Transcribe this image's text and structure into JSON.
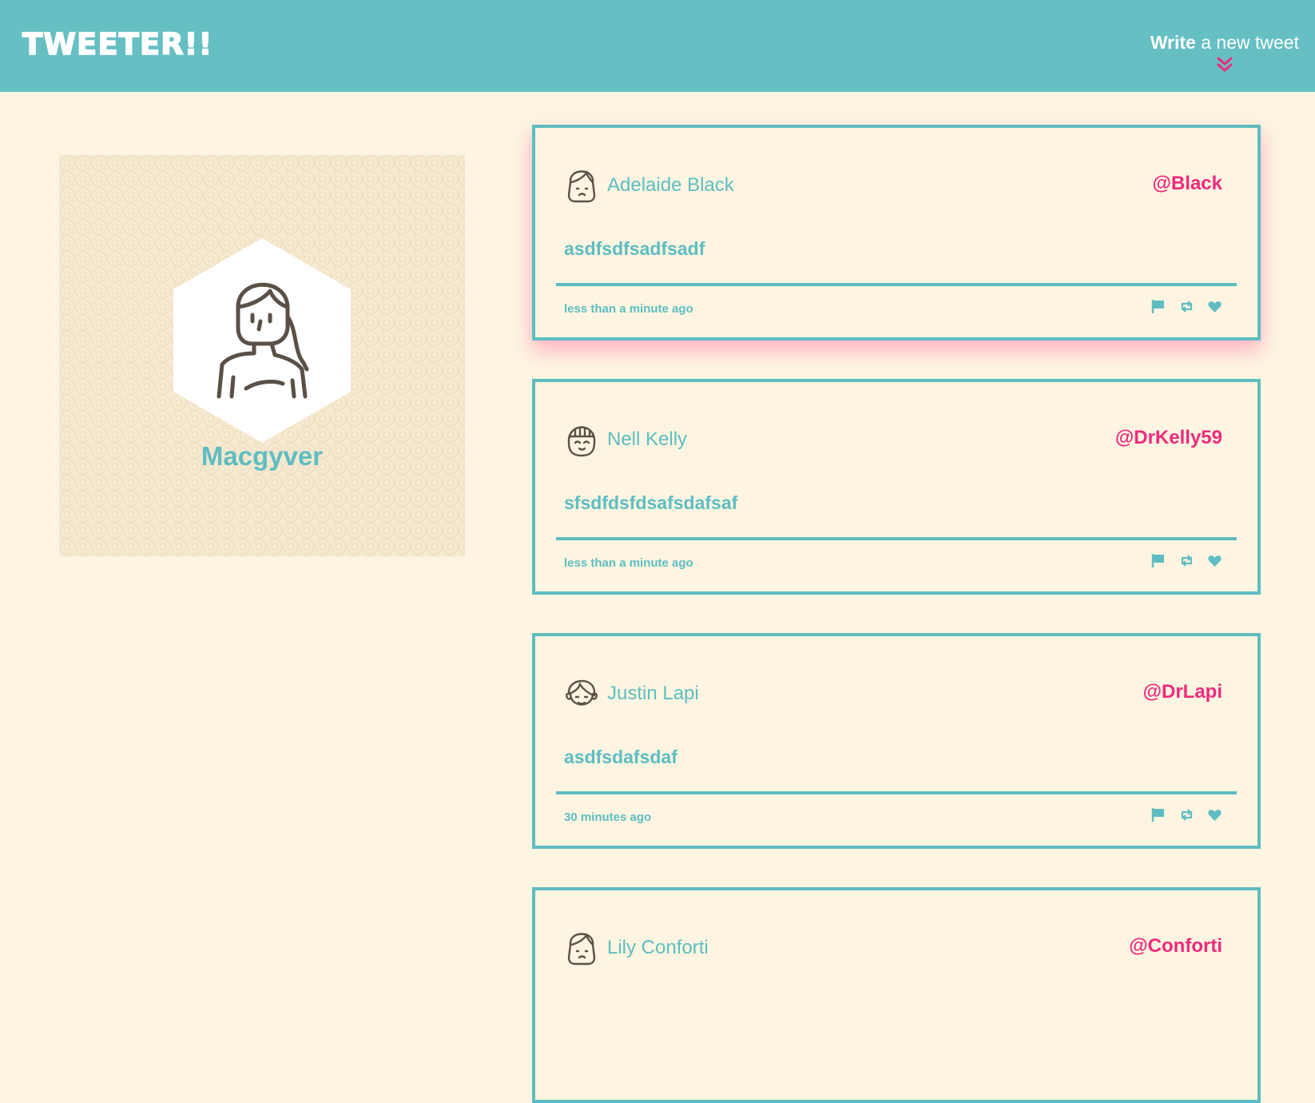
{
  "nav": {
    "brand": "TWEETER!!",
    "compose_bold": "Write",
    "compose_rest": " a new tweet"
  },
  "profile": {
    "name": "Macgyver"
  },
  "tweets": [
    {
      "author": "Adelaide Black",
      "handle": "@Black",
      "text": "asdfsdfsadfsadf",
      "time": "less than a minute ago"
    },
    {
      "author": "Nell Kelly",
      "handle": "@DrKelly59",
      "text": "sfsdfdsfdsafsdafsaf",
      "time": "less than a minute ago"
    },
    {
      "author": "Justin Lapi",
      "handle": "@DrLapi",
      "text": "asdfsdafsdaf",
      "time": "30 minutes ago"
    },
    {
      "author": "Lily Conforti",
      "handle": "@Conforti",
      "text": "",
      "time": ""
    }
  ],
  "icons": {
    "compose": "chevron-double-down-icon",
    "flag": "flag-icon",
    "retweet": "retweet-icon",
    "like": "heart-icon"
  },
  "colors": {
    "navbar": "#65bfc3",
    "background": "#fdf5e1",
    "accent": "#5ebdc2",
    "handle": "#f02a7c"
  }
}
